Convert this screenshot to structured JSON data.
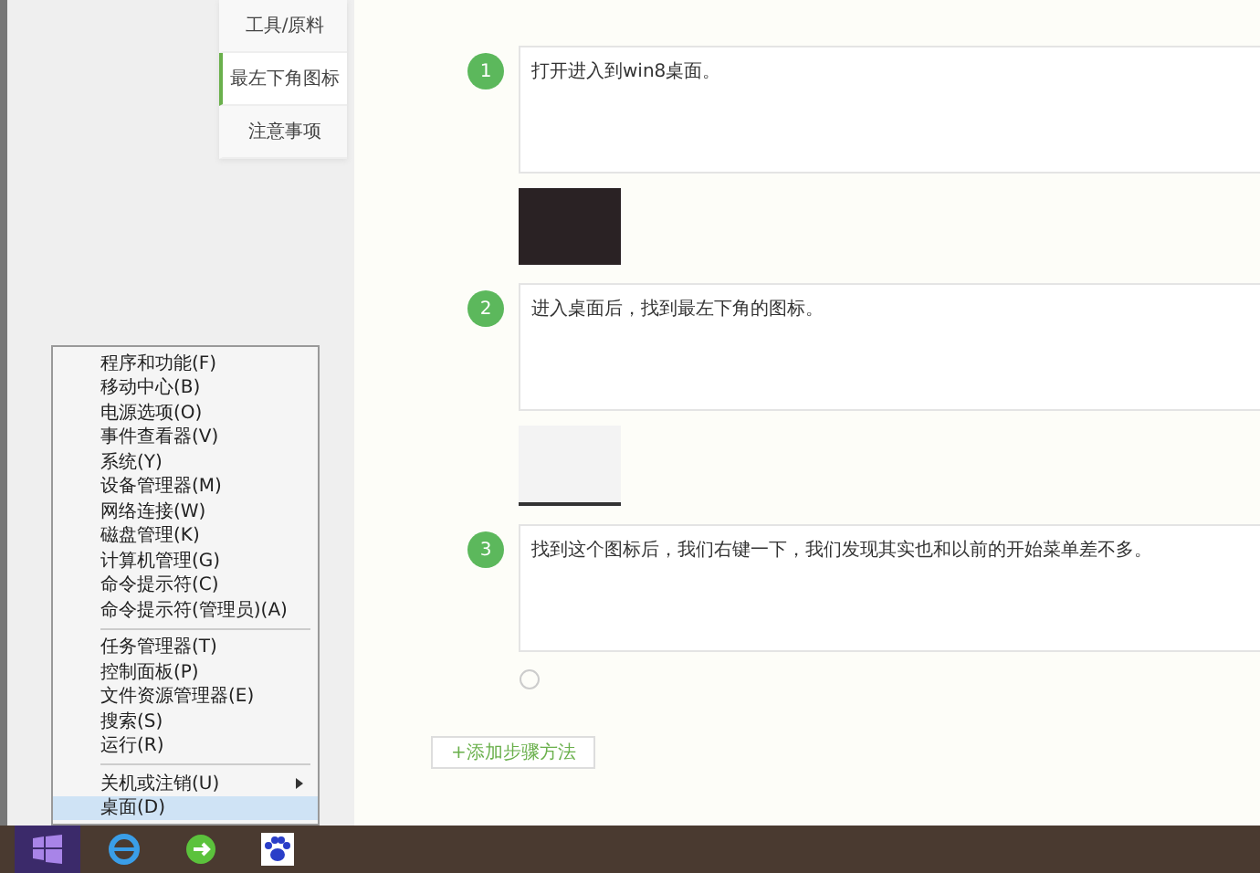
{
  "side_nav": {
    "items": [
      {
        "label": "工具/原料",
        "selected": false
      },
      {
        "label": "最左下角图标",
        "selected": true
      },
      {
        "label": "注意事项",
        "selected": false
      }
    ]
  },
  "steps": [
    {
      "number": "1",
      "text": "打开进入到win8桌面。",
      "kind": "photo"
    },
    {
      "number": "2",
      "text": "进入桌面后，找到最左下角的图标。",
      "kind": "screenshot"
    },
    {
      "number": "3",
      "text": "找到这个图标后，我们右键一下，我们发现其实也和以前的开始菜单差不多。",
      "kind": "hint"
    }
  ],
  "add_button": {
    "label": "+添加步骤方法"
  },
  "context_menu": {
    "items": [
      {
        "kind": "item",
        "label": "程序和功能(F)",
        "selected": false
      },
      {
        "kind": "item",
        "label": "移动中心(B)",
        "selected": false
      },
      {
        "kind": "item",
        "label": "电源选项(O)",
        "selected": false
      },
      {
        "kind": "item",
        "label": "事件查看器(V)",
        "selected": false
      },
      {
        "kind": "item",
        "label": "系统(Y)",
        "selected": false
      },
      {
        "kind": "item",
        "label": "设备管理器(M)",
        "selected": false
      },
      {
        "kind": "item",
        "label": "网络连接(W)",
        "selected": false
      },
      {
        "kind": "item",
        "label": "磁盘管理(K)",
        "selected": false
      },
      {
        "kind": "item",
        "label": "计算机管理(G)",
        "selected": false
      },
      {
        "kind": "item",
        "label": "命令提示符(C)",
        "selected": false
      },
      {
        "kind": "item",
        "label": "命令提示符(管理员)(A)",
        "selected": false
      },
      {
        "kind": "separator"
      },
      {
        "kind": "item",
        "label": "任务管理器(T)",
        "selected": false
      },
      {
        "kind": "item",
        "label": "控制面板(P)",
        "selected": false
      },
      {
        "kind": "item",
        "label": "文件资源管理器(E)",
        "selected": false
      },
      {
        "kind": "item",
        "label": "搜索(S)",
        "selected": false
      },
      {
        "kind": "item",
        "label": "运行(R)",
        "selected": false
      },
      {
        "kind": "separator"
      },
      {
        "kind": "submenu",
        "label": "关机或注销(U)",
        "selected": false
      },
      {
        "kind": "item",
        "label": "桌面(D)",
        "selected": true
      }
    ]
  },
  "taskbar": {
    "apps": [
      {
        "kind": "start",
        "active": true
      },
      {
        "kind": "ie",
        "active": false
      },
      {
        "kind": "green",
        "active": false
      },
      {
        "kind": "paw",
        "active": false
      }
    ]
  }
}
